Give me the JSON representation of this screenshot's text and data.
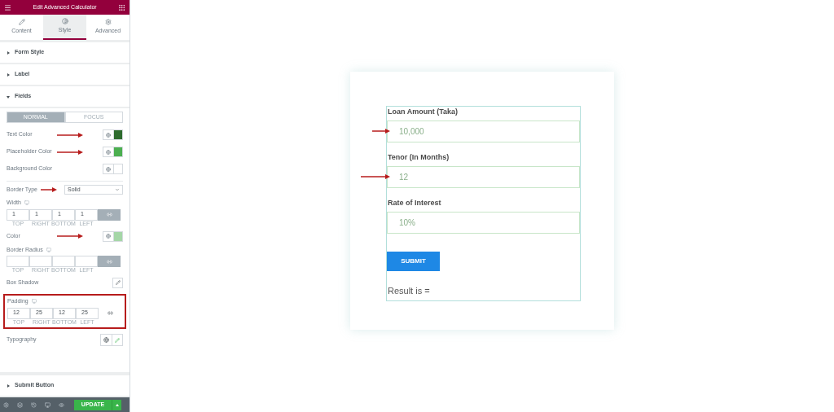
{
  "panel": {
    "title": "Edit Advanced Calculator",
    "tabs": [
      {
        "label": "Content",
        "selected": false
      },
      {
        "label": "Style",
        "selected": true
      },
      {
        "label": "Advanced",
        "selected": false
      }
    ],
    "sections": [
      {
        "label": "Form Style",
        "expanded": false
      },
      {
        "label": "Label",
        "expanded": false
      },
      {
        "label": "Fields",
        "expanded": true
      }
    ],
    "state_tabs": [
      {
        "label": "NORMAL",
        "selected": true
      },
      {
        "label": "FOCUS",
        "selected": false
      }
    ],
    "controls": [
      {
        "kind": "color",
        "label": "Text Color",
        "color": "#2e6b2e",
        "annotated": true
      },
      {
        "kind": "color",
        "label": "Placeholder Color",
        "color": "#4caf50",
        "annotated": true
      },
      {
        "kind": "color",
        "label": "Background Color",
        "color": "#ffffff",
        "annotated": false
      },
      {
        "kind": "select",
        "label": "Border Type",
        "value": "Solid",
        "annotated": true
      },
      {
        "kind": "dimensions",
        "label": "Width",
        "values": [
          "1",
          "1",
          "1",
          "1"
        ],
        "units": [
          "TOP",
          "RIGHT",
          "BOTTOM",
          "LEFT"
        ],
        "highlighted": false
      },
      {
        "kind": "color",
        "label": "Color",
        "color": "#a5d6a7",
        "annotated": true
      },
      {
        "kind": "dimensions",
        "label": "Border Radius",
        "units": [
          "TOP",
          "RIGHT",
          "BOTTOM",
          "LEFT"
        ],
        "highlighted": false
      },
      {
        "kind": "popover",
        "label": "Box Shadow"
      },
      {
        "kind": "dimensions",
        "label": "Padding",
        "values": [
          "12",
          "25",
          "12",
          "25"
        ],
        "units": [
          "TOP",
          "RIGHT",
          "BOTTOM",
          "LEFT"
        ],
        "highlighted": true
      },
      {
        "kind": "typography",
        "label": "Typography"
      }
    ],
    "next_section": {
      "label": "Submit Button",
      "expanded": false
    },
    "update_button": "UPDATE"
  },
  "form": {
    "fields": [
      {
        "label": "Loan Amount (Taka)",
        "placeholder": "10,000",
        "annotated": true
      },
      {
        "label": "Tenor (In Months)",
        "placeholder": "12",
        "annotated": true
      },
      {
        "label": "Rate of Interest",
        "placeholder": "10%",
        "annotated": false
      }
    ],
    "submit": "SUBMIT",
    "result": "Result is ="
  }
}
